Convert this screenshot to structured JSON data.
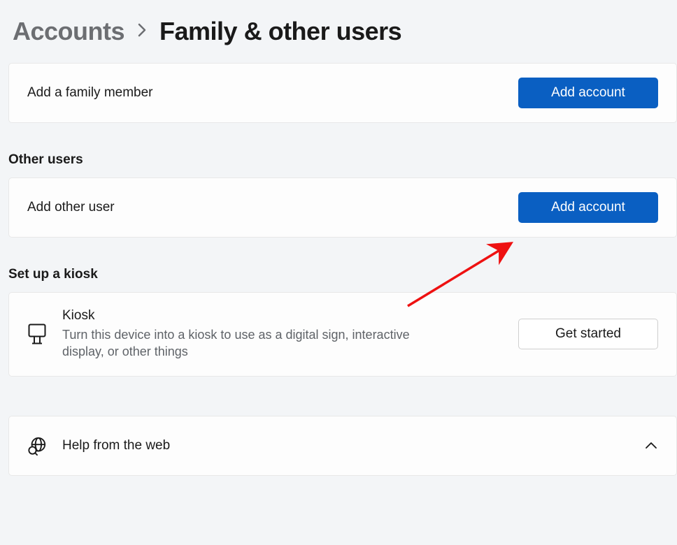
{
  "breadcrumb": {
    "parent": "Accounts",
    "current": "Family & other users"
  },
  "family": {
    "row_label": "Add a family member",
    "button": "Add account"
  },
  "other_users": {
    "header": "Other users",
    "row_label": "Add other user",
    "button": "Add account"
  },
  "kiosk": {
    "header": "Set up a kiosk",
    "title": "Kiosk",
    "description": "Turn this device into a kiosk to use as a digital sign, interactive display, or other things",
    "button": "Get started"
  },
  "help": {
    "title": "Help from the web"
  }
}
